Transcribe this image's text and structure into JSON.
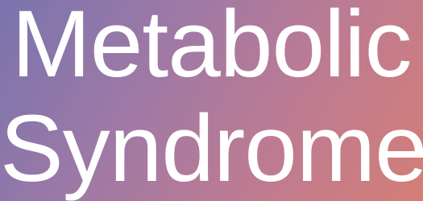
{
  "slide": {
    "title_line_1": "Metabolic",
    "title_line_2": "Syndrome"
  },
  "colors": {
    "gradient_start": "#7a74ae",
    "gradient_mid": "#bc7b93",
    "gradient_end": "#d47e76",
    "text": "#ffffff"
  }
}
